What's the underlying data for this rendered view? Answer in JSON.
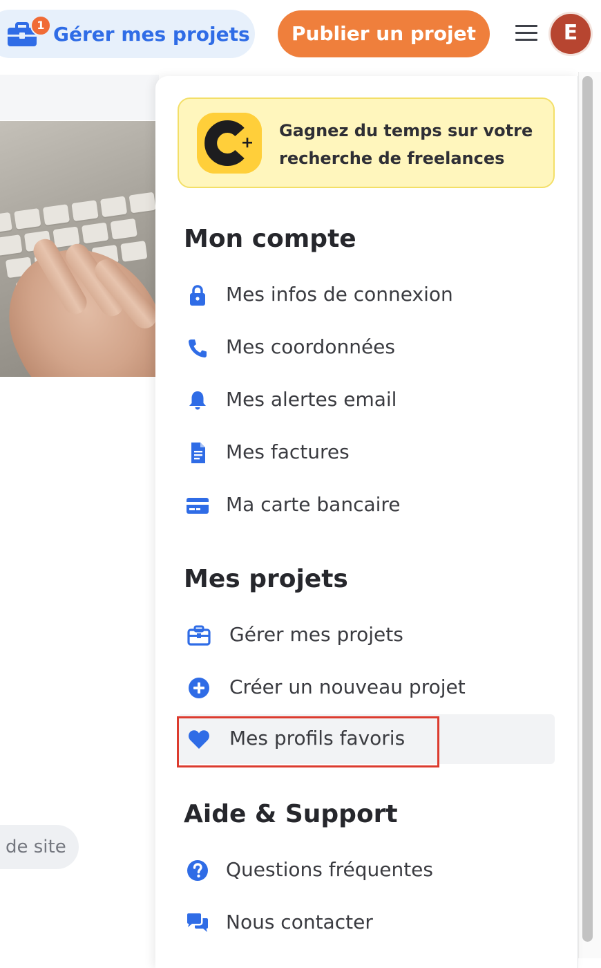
{
  "colors": {
    "accent_blue": "#2f6ce6",
    "publish_orange": "#ef7f3c",
    "notification_orange": "#f06b36",
    "avatar_red": "#b74530",
    "promo_yellow": "#fff6bd",
    "highlight_red": "#dc3b2e"
  },
  "header": {
    "manage_projects_label": "Gérer mes projets",
    "notification_count": "1",
    "publish_label": "Publier un projet",
    "avatar_initial": "E",
    "menu_icon": "hamburger-icon"
  },
  "background": {
    "site_pill_text": "de site"
  },
  "menu": {
    "promo": {
      "logo_letter": "C",
      "logo_plus": "+",
      "text": "Gagnez du temps sur votre recherche de freelances"
    },
    "sections": [
      {
        "title": "Mon compte",
        "items": [
          {
            "label": "Mes infos de connexion",
            "icon": "lock-icon"
          },
          {
            "label": "Mes coordonnées",
            "icon": "phone-icon"
          },
          {
            "label": "Mes alertes email",
            "icon": "bell-icon"
          },
          {
            "label": "Mes factures",
            "icon": "invoice-icon"
          },
          {
            "label": "Ma carte bancaire",
            "icon": "credit-card-icon"
          }
        ]
      },
      {
        "title": "Mes projets",
        "items": [
          {
            "label": "Gérer mes projets",
            "icon": "briefcase-icon"
          },
          {
            "label": "Créer un nouveau projet",
            "icon": "plus-circle-icon"
          },
          {
            "label": "Mes profils favoris",
            "icon": "heart-icon",
            "state": "hovered"
          }
        ]
      },
      {
        "title": "Aide & Support",
        "items": [
          {
            "label": "Questions fréquentes",
            "icon": "question-circle-icon"
          },
          {
            "label": "Nous contacter",
            "icon": "chat-bubbles-icon"
          }
        ]
      }
    ]
  }
}
